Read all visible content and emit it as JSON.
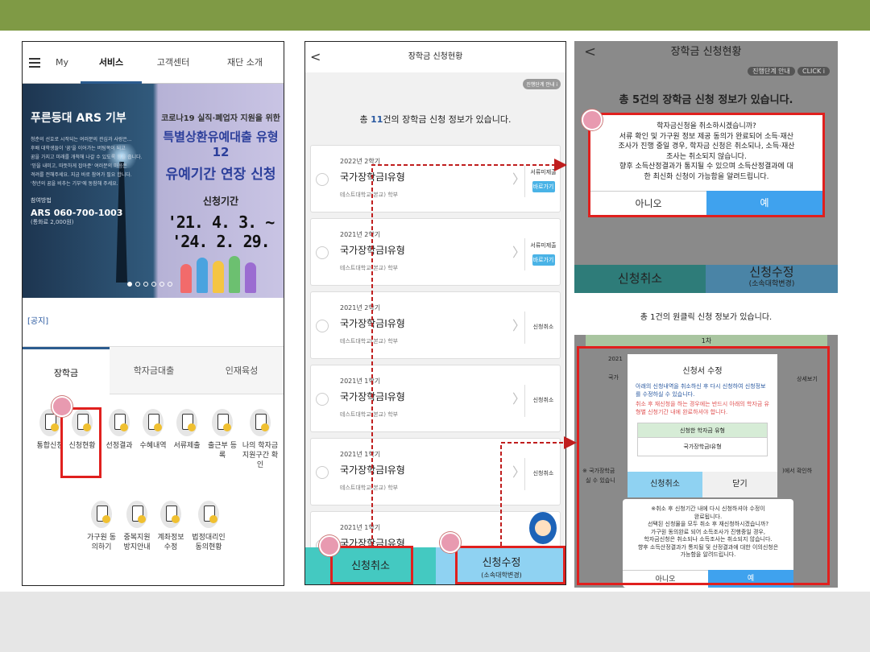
{
  "phone1": {
    "nav": {
      "my": "My",
      "service": "서비스",
      "customer": "고객센터",
      "foundation": "재단 소개"
    },
    "banner": {
      "title": "푸른등대 ARS 기부",
      "lines": [
        "청춘의 선호로 시작되는 여러분의 관심과 사랑은...",
        "후배 대학생들이 '꿈'을 이어가는 버팀목이 되고",
        "꿈을 가지고 미래를 개척해 나갈 수 있도록 힘을 줍니다.",
        "'믿을 내미고, 따뜻하게 잡아준' 여러분의 마음은",
        "격려를 전해주세요. 지금 바로 참여가 필요 합니다.",
        "'청년의 꿈을 비추는 기부'에 동참해 주세요."
      ],
      "ars_label": "참여방법",
      "ars": "ARS 060-700-1003",
      "fee": "(통화료 2,000원)",
      "r1": "코로나19 실직·폐업자 지원을 위한",
      "r2": "특별상환유예대출 유형12",
      "r3": "유예기간 연장 신청",
      "r4": "신청기간",
      "r5": "'21. 4. 3. ~ '24. 2. 29."
    },
    "notice": "[공지]",
    "tabs": {
      "scholarship": "장학금",
      "loan": "학자금대출",
      "talent": "인재육성"
    },
    "services": [
      {
        "label": "통합신청"
      },
      {
        "label": "신청현황"
      },
      {
        "label": "선정결과"
      },
      {
        "label": "수혜내역"
      },
      {
        "label": "서류제출"
      },
      {
        "label": "출근부 등록"
      },
      {
        "label": "나의 학자금 지원구간 확인"
      },
      {
        "label": "가구원 동의하기"
      },
      {
        "label": "중복지원 방지안내"
      },
      {
        "label": "계좌정보 수정"
      },
      {
        "label": "법정대리인 동의현황"
      }
    ]
  },
  "phone2": {
    "title": "장학금 신청현황",
    "back": "<",
    "guide": "진행단계 안내 i",
    "total_prefix": "총 ",
    "total_count": "11",
    "total_suffix": "건의 장학금 신청 정보가 있습니다.",
    "cards": [
      {
        "term": "2022년 2학기",
        "name": "국가장학금I유형",
        "school": "테스트대학교(본교) 학부",
        "status": "서류미제출",
        "action": "바로가기"
      },
      {
        "term": "2021년 2학기",
        "name": "국가장학금I유형",
        "school": "테스트대학교(본교) 학부",
        "status": "서류미제출",
        "action": "바로가기"
      },
      {
        "term": "2021년 2학기",
        "name": "국가장학금I유형",
        "school": "테스트대학교(본교) 학부",
        "status": "신청취소",
        "action": ""
      },
      {
        "term": "2021년 1학기",
        "name": "국가장학금I유형",
        "school": "테스트대학교(본교) 학부",
        "status": "신청취소",
        "action": ""
      },
      {
        "term": "2021년 1학기",
        "name": "국가장학금I유형",
        "school": "테스트대학교(본교) 학부",
        "status": "신청취소",
        "action": ""
      },
      {
        "term": "2021년 1학기",
        "name": "국가장학금I유형",
        "school": "",
        "status": "",
        "action": ""
      }
    ],
    "cancel": "신청취소",
    "modify": "신청수정",
    "modify_sub": "(소속대학변경)"
  },
  "phone3": {
    "title": "장학금 신청현황",
    "guide": "진행단계 안내",
    "guide_badge": "CLICK i",
    "total": "총 5건의 장학금 신청 정보가 있습니다.",
    "dialog": {
      "lines": [
        "학자금신청을 취소하시겠습니까?",
        "서류 확인 및 가구원 정보 제공 동의가 완료되어 소득·재산",
        "조사가 진행 중일 경우, 학자금 신청은 취소되나, 소득·재산",
        "조사는 취소되지 않습니다.",
        "향후 소득산정결과가 통지될 수 있으며 소득산정결과에 대",
        "한 최신화 신청이 가능함을 알려드립니다."
      ],
      "no": "아니오",
      "yes": "예"
    },
    "cancel": "신청취소",
    "modify": "신청수정",
    "modify_sub": "(소속대학변경)"
  },
  "phone4": {
    "total": "총 1건의 원클릭 신청 정보가 있습니다.",
    "round": "1차",
    "side_left": "2021",
    "side_left2": "국가",
    "side_right": "상세보기",
    "note_left": "※ 국가장학금",
    "note_left2": "실 수 있습니",
    "note_right": ")에서 확인하",
    "dialog": {
      "title": "신청서 수정",
      "msg": "아래의 신청내역을 취소하신 후 다시 신청하여 신청정보를 수정하실 수 있습니다.",
      "warn": "취소 후 재신청을 하는 경우에는 반드시 아래의 학자금 유형별 신청기간 내에 완료하셔야 합니다.",
      "table_header": "신청한 학자금 유형",
      "table_value": "국가장학금I유형",
      "cancel": "신청취소",
      "close": "닫기"
    },
    "dialog2": {
      "lines": [
        "※취소 후 신청기간 내에 다시 신청하셔야 수정이",
        "완료됩니다.",
        "선택된 신청물을 모두 취소 후 재신청하시겠습니까?",
        "가구원 동의완료 되어 소득조사가 진행중일 경우,",
        "학자금신청은 취소되나 소득조사는 취소되지 않습니다.",
        "향후 소득산정결과가 통지될 및 산정결과에 대한 이의신청은",
        "가능함을 알려드립니다."
      ],
      "no": "아니오",
      "yes": "예"
    }
  },
  "colors": {
    "accent_bar": "#7f9a45",
    "highlight": "#e0201e",
    "teal_button": "#44c9c1",
    "blue_button": "#8fd2f2"
  }
}
